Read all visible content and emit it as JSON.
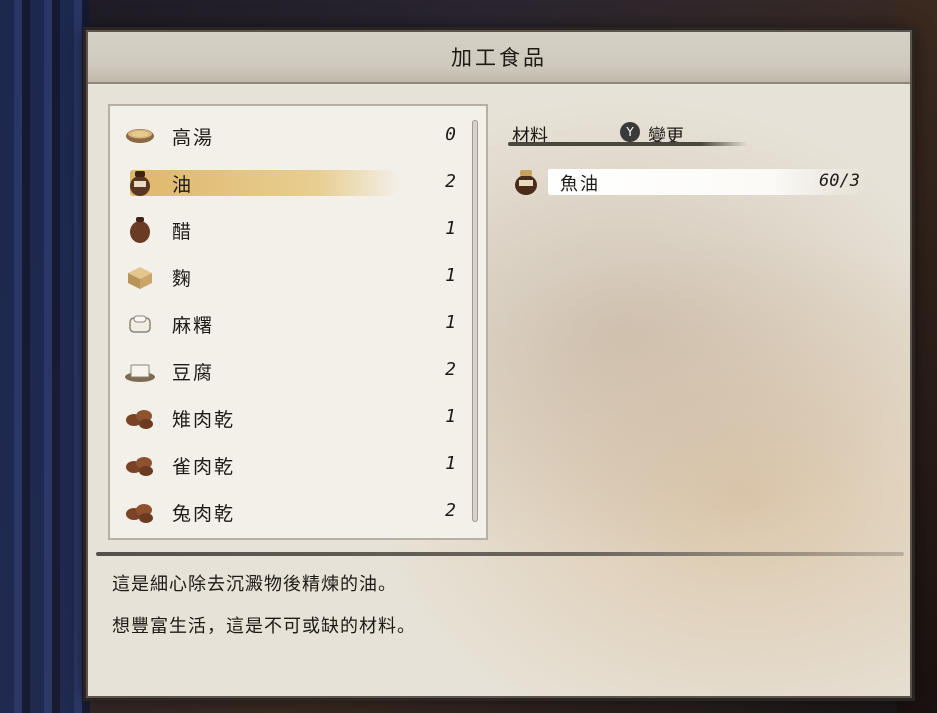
{
  "window": {
    "title": "加工食品"
  },
  "items": [
    {
      "name": "高湯",
      "count": "0",
      "icon": "bowl-icon",
      "selected": false
    },
    {
      "name": "油",
      "count": "2",
      "icon": "oil-jar-icon",
      "selected": true
    },
    {
      "name": "醋",
      "count": "1",
      "icon": "vinegar-jar-icon",
      "selected": false
    },
    {
      "name": "麴",
      "count": "1",
      "icon": "koji-block-icon",
      "selected": false
    },
    {
      "name": "麻糬",
      "count": "1",
      "icon": "mochi-icon",
      "selected": false
    },
    {
      "name": "豆腐",
      "count": "2",
      "icon": "tofu-icon",
      "selected": false
    },
    {
      "name": "雉肉乾",
      "count": "1",
      "icon": "jerky-icon",
      "selected": false
    },
    {
      "name": "雀肉乾",
      "count": "1",
      "icon": "jerky-icon",
      "selected": false
    },
    {
      "name": "兔肉乾",
      "count": "2",
      "icon": "jerky-icon",
      "selected": false
    }
  ],
  "materials": {
    "label": "材料",
    "button_glyph": "Y",
    "change_label": "變更",
    "rows": [
      {
        "name": "魚油",
        "quantity": "60/3",
        "icon": "fish-oil-jar-icon"
      }
    ]
  },
  "description": {
    "line1": "這是細心除去沉澱物後精煉的油。",
    "line2": "想豐富生活，這是不可或缺的材料。"
  }
}
